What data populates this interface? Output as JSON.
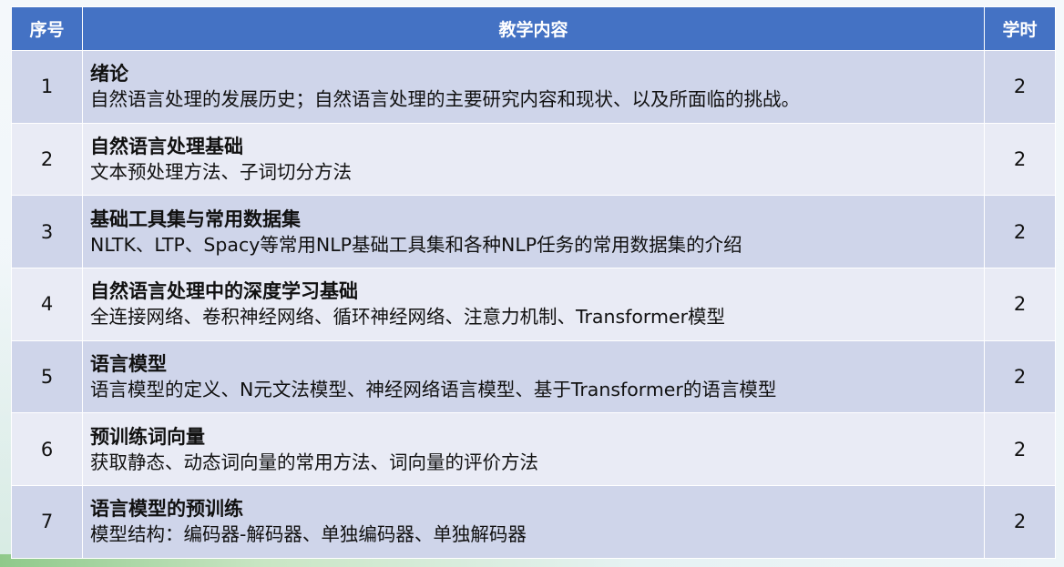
{
  "table": {
    "headers": {
      "no": "序号",
      "content": "教学内容",
      "hours": "学时"
    },
    "rows": [
      {
        "no": "1",
        "title": "绪论",
        "desc": "自然语言处理的发展历史；自然语言处理的主要研究内容和现状、以及所面临的挑战。",
        "hours": "2"
      },
      {
        "no": "2",
        "title": "自然语言处理基础",
        "desc": "文本预处理方法、子词切分方法",
        "hours": "2"
      },
      {
        "no": "3",
        "title": "基础工具集与常用数据集",
        "desc": "NLTK、LTP、Spacy等常用NLP基础工具集和各种NLP任务的常用数据集的介绍",
        "hours": "2"
      },
      {
        "no": "4",
        "title": "自然语言处理中的深度学习基础",
        "desc": "全连接网络、卷积神经网络、循环神经网络、注意力机制、Transformer模型",
        "hours": "2"
      },
      {
        "no": "5",
        "title": "语言模型",
        "desc": "语言模型的定义、N元文法模型、神经网络语言模型、基于Transformer的语言模型",
        "hours": "2"
      },
      {
        "no": "6",
        "title": "预训练词向量",
        "desc": "获取静态、动态词向量的常用方法、词向量的评价方法",
        "hours": "2"
      },
      {
        "no": "7",
        "title": "语言模型的预训练",
        "desc": "模型结构：编码器-解码器、单独编码器、单独解码器",
        "hours": "2"
      }
    ]
  },
  "colors": {
    "header_bg": "#4472c4",
    "row_dark": "#cfd5ea",
    "row_light": "#e9ebf5"
  }
}
